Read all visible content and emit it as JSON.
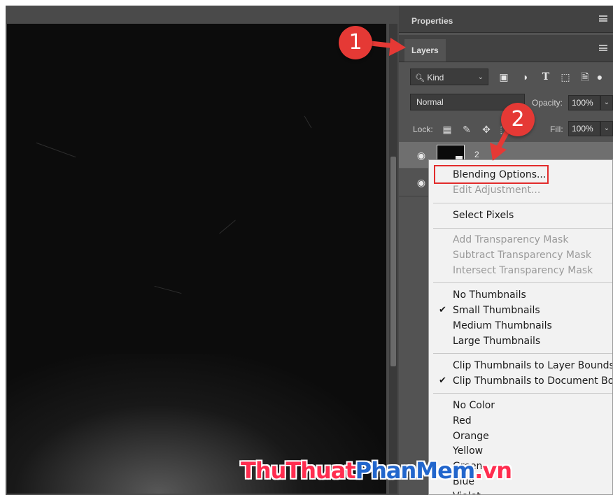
{
  "panel": {
    "properties_tab": "Properties",
    "layers_tab": "Layers",
    "filter": {
      "kind_label": "Kind"
    },
    "blend_mode": "Normal",
    "opacity_label": "Opacity:",
    "opacity_value": "100%",
    "lock_label": "Lock:",
    "fill_label": "Fill:",
    "fill_value": "100%",
    "layers": [
      {
        "name": "2",
        "selected": true
      },
      {
        "name": "",
        "selected": false
      }
    ]
  },
  "context_menu": {
    "groups": [
      [
        {
          "label": "Blending Options...",
          "disabled": false
        },
        {
          "label": "Edit Adjustment...",
          "disabled": true
        }
      ],
      [
        {
          "label": "Select Pixels",
          "disabled": false
        }
      ],
      [
        {
          "label": "Add Transparency Mask",
          "disabled": true
        },
        {
          "label": "Subtract Transparency Mask",
          "disabled": true
        },
        {
          "label": "Intersect Transparency Mask",
          "disabled": true
        }
      ],
      [
        {
          "label": "No Thumbnails",
          "checked": false
        },
        {
          "label": "Small Thumbnails",
          "checked": true
        },
        {
          "label": "Medium Thumbnails",
          "checked": false
        },
        {
          "label": "Large Thumbnails",
          "checked": false
        }
      ],
      [
        {
          "label": "Clip Thumbnails to Layer Bounds",
          "checked": false
        },
        {
          "label": "Clip Thumbnails to Document Bou",
          "checked": true
        }
      ],
      [
        {
          "label": "No Color"
        },
        {
          "label": "Red"
        },
        {
          "label": "Orange"
        },
        {
          "label": "Yellow"
        },
        {
          "label": "Green"
        },
        {
          "label": "Blue"
        },
        {
          "label": "Violet"
        }
      ]
    ]
  },
  "annotations": {
    "step1": "1",
    "step2": "2",
    "highlight_color": "#e22b2b",
    "badge_color": "#e53935"
  },
  "watermark": {
    "part1": "ThuThuat",
    "part2": "PhanMem",
    "part3": ".vn"
  }
}
